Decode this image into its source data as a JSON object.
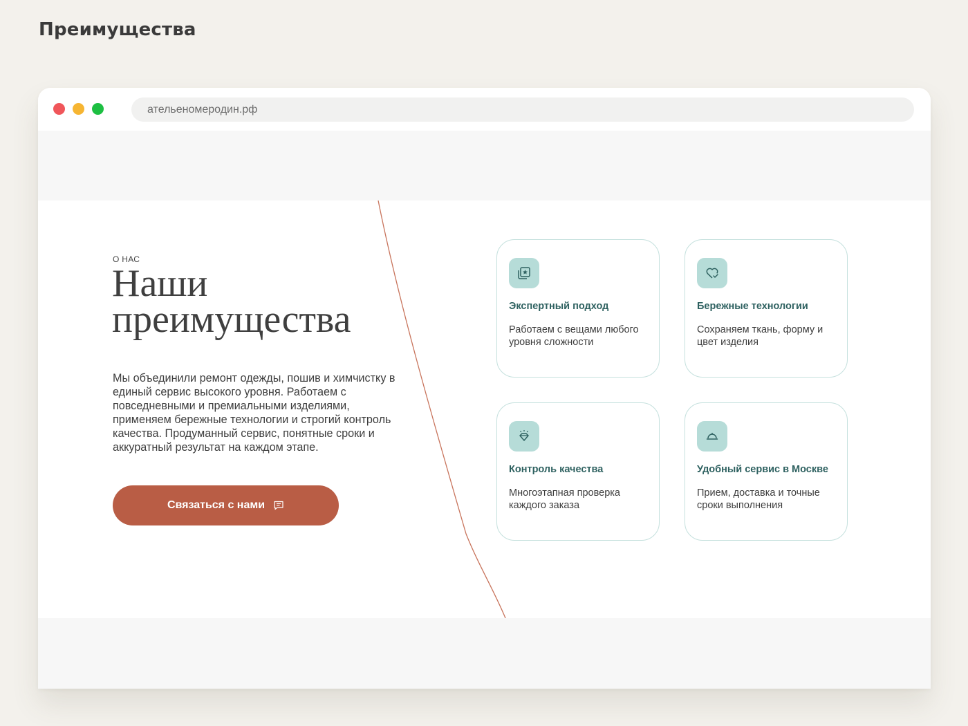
{
  "page": {
    "heading": "Преимущества"
  },
  "browser": {
    "url": "ательеномеродин.рф"
  },
  "about": {
    "eyebrow": "О НАС",
    "title": "Наши преимущества",
    "description": "Мы объединили ремонт одежды, пошив и химчистку в единый сервис высокого уровня. Работаем с повседневными и премиальными изделиями, применяем бережные технологии и строгий контроль качества. Продуманный сервис, понятные сроки и аккуратный результат на каждом этапе.",
    "cta_label": "Связаться с нами"
  },
  "cards": [
    {
      "icon": "expert-badge-icon",
      "title": "Экспертный подход",
      "text": "Работаем с вещами любого уровня сложности"
    },
    {
      "icon": "heart-check-icon",
      "title": "Бережные технологии",
      "text": "Сохраняем ткань, форму и цвет изделия"
    },
    {
      "icon": "diamond-sparkle-icon",
      "title": "Контроль качества",
      "text": "Многоэтапная проверка каждого заказа"
    },
    {
      "icon": "cloche-service-icon",
      "title": "Удобный сервис в Москве",
      "text": "Прием, доставка и точные сроки выполнения"
    }
  ],
  "colors": {
    "accent": "#b95d45",
    "card_border": "#c4e0dd",
    "icon_bg": "#b6dcd8",
    "card_title": "#2e6160",
    "curve": "#c8745c"
  }
}
